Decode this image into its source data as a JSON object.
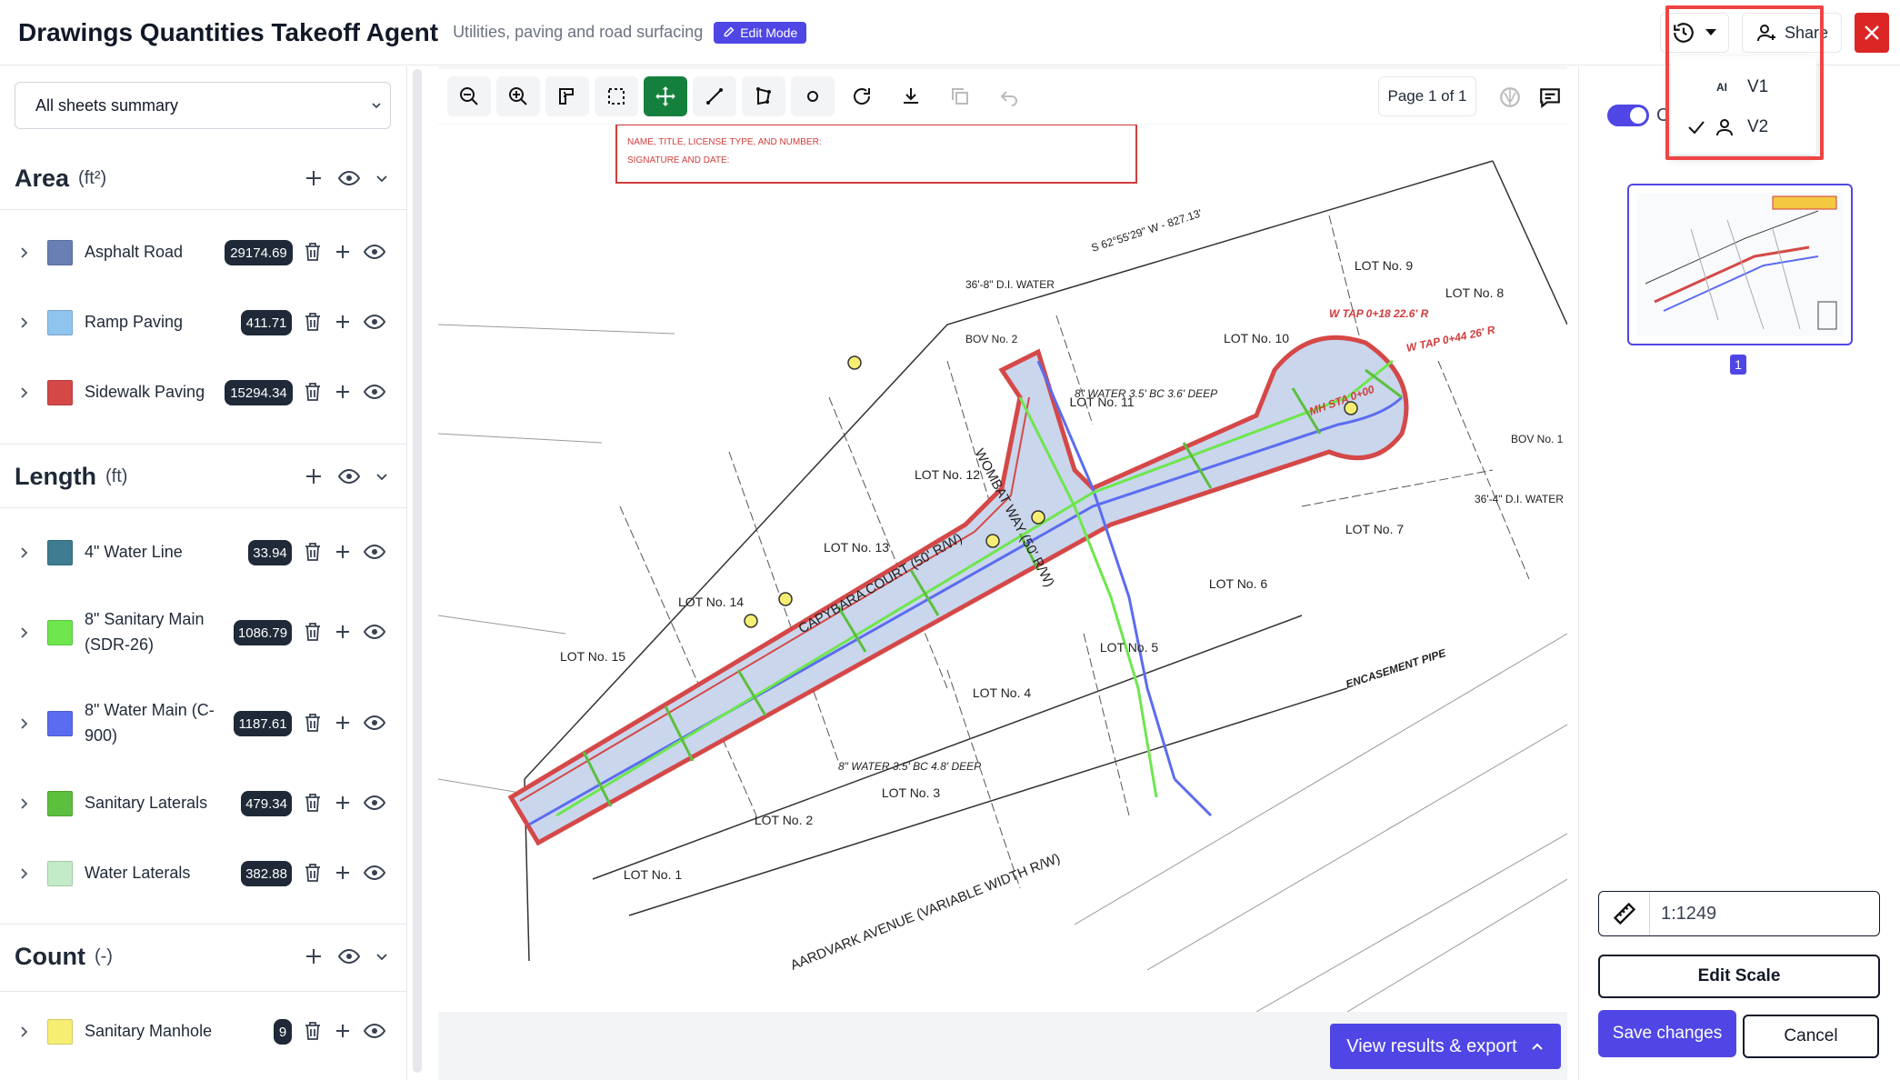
{
  "header": {
    "title": "Drawings Quantities Takeoff Agent",
    "subtitle": "Utilities, paving and road surfacing",
    "edit_mode_label": "Edit Mode",
    "share_label": "Share"
  },
  "history_menu": {
    "items": [
      {
        "icon": "ai-icon",
        "icon_text": "AI",
        "label": "V1",
        "checked": false
      },
      {
        "icon": "user-icon",
        "icon_text": "",
        "label": "V2",
        "checked": true
      }
    ]
  },
  "sidebar": {
    "sheet_select": "All sheets summary",
    "sections": [
      {
        "title": "Area",
        "unit": "(ft²)",
        "items": [
          {
            "label": "Asphalt Road",
            "value": "29174.69",
            "color": "#6a7fb4"
          },
          {
            "label": "Ramp Paving",
            "value": "411.71",
            "color": "#8fc4ee"
          },
          {
            "label": "Sidewalk Paving",
            "value": "15294.34",
            "color": "#d54848"
          }
        ]
      },
      {
        "title": "Length",
        "unit": "(ft)",
        "items": [
          {
            "label": "4\" Water Line",
            "value": "33.94",
            "color": "#3e7c92"
          },
          {
            "label": "8\" Sanitary Main",
            "label2": "(SDR-26)",
            "value": "1086.79",
            "color": "#6ee64d"
          },
          {
            "label": "8\" Water Main (C-",
            "label2": "900)",
            "value": "1187.61",
            "color": "#5b6cf0"
          },
          {
            "label": "Sanitary Laterals",
            "value": "479.34",
            "color": "#5cbf3d"
          },
          {
            "label": "Water Laterals",
            "value": "382.88",
            "color": "#c4ebc8"
          }
        ]
      },
      {
        "title": "Count",
        "unit": "(-)",
        "items": [
          {
            "label": "Sanitary Manhole",
            "value": "9",
            "color": "#f5ee72"
          }
        ]
      }
    ]
  },
  "toolbar": {
    "page_indicator": "Page 1 of 1"
  },
  "drawing": {
    "lots": [
      "LOT No. 1",
      "LOT No. 2",
      "LOT No. 3",
      "LOT No. 4",
      "LOT No. 5",
      "LOT No. 6",
      "LOT No. 7",
      "LOT No. 8",
      "LOT No. 9",
      "LOT No. 10",
      "LOT No. 11",
      "LOT No. 12",
      "LOT No. 13",
      "LOT No. 14",
      "LOT No. 15"
    ],
    "streets": [
      "CAPYBARA COURT (50' R/W)",
      "WOMBAT WAY (50' R/W)",
      "AARDVARK AVENUE (VARIABLE WIDTH R/W)"
    ],
    "notes": [
      "NAME, TITLE, LICENSE TYPE, AND NUMBER:",
      "SIGNATURE AND DATE:",
      "S 62°55'29\" W - 827.13'",
      "36'-8\" D.I. WATER",
      "BOV No. 2",
      "BOV No. 1",
      "MH STA 0+00",
      "W TAP 0+18 22.6' R",
      "W TAP 0+44 26' R",
      "ENCASEMENT PIPE",
      "36'-4\" D.I. WATER",
      "8\" WATER 3.5' BC 4.8' DEEP",
      "8\" WATER 3.5' BC 3.6' DEEP"
    ]
  },
  "results_button": "View results & export",
  "right_panel": {
    "toggle_label": "C                 ets",
    "thumbnail_page": "1",
    "scale": "1:1249",
    "edit_scale": "Edit Scale",
    "save": "Save changes",
    "cancel": "Cancel"
  }
}
